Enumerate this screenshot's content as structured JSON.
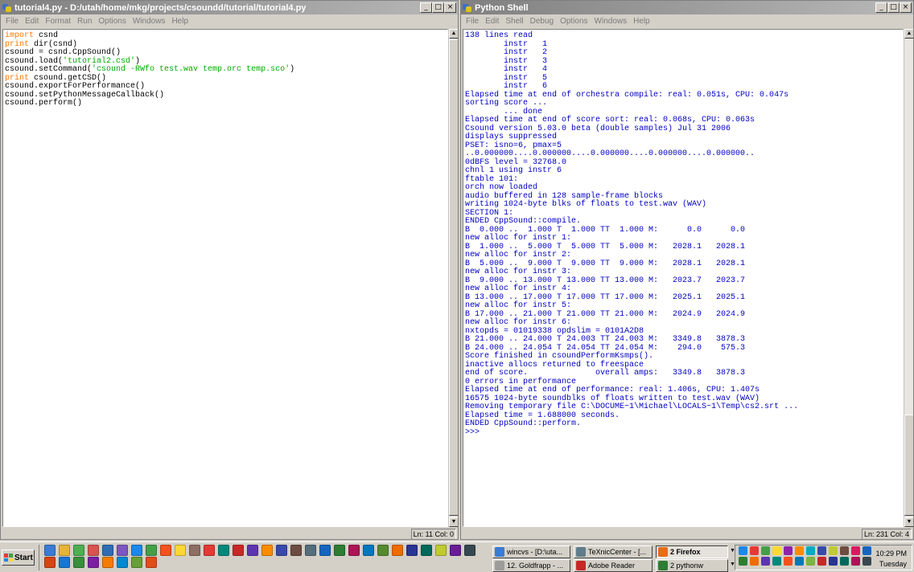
{
  "left_window": {
    "title": "tutorial4.py - D:/utah/home/mkg/projects/csoundd/tutorial/tutorial4.py",
    "caption_buttons": [
      "_",
      "□",
      "×"
    ],
    "menu": [
      "File",
      "Edit",
      "Format",
      "Run",
      "Options",
      "Windows",
      "Help"
    ],
    "code": [
      [
        {
          "t": "import",
          "c": "kw"
        },
        {
          "t": " csnd",
          "c": ""
        }
      ],
      [
        {
          "t": "print",
          "c": "kw"
        },
        {
          "t": " dir(csnd)",
          "c": ""
        }
      ],
      [
        {
          "t": "csound = csnd.CppSound()",
          "c": ""
        }
      ],
      [
        {
          "t": "csound.load(",
          "c": ""
        },
        {
          "t": "'tutorial2.csd'",
          "c": "str"
        },
        {
          "t": ")",
          "c": ""
        }
      ],
      [
        {
          "t": "csound.setCommand(",
          "c": ""
        },
        {
          "t": "'csound -RWfo test.wav temp.orc temp.sco'",
          "c": "str"
        },
        {
          "t": ")",
          "c": ""
        }
      ],
      [
        {
          "t": "print",
          "c": "kw"
        },
        {
          "t": " csound.getCSD()",
          "c": ""
        }
      ],
      [
        {
          "t": "csound.exportForPerformance()",
          "c": ""
        }
      ],
      [
        {
          "t": "csound.setPythonMessageCallback()",
          "c": ""
        }
      ],
      [
        {
          "t": "csound.perform()",
          "c": ""
        }
      ]
    ],
    "status": "Ln: 11 Col: 0"
  },
  "right_window": {
    "title": "Python Shell",
    "caption_buttons": [
      "_",
      "□",
      "×"
    ],
    "menu": [
      "File",
      "Edit",
      "Shell",
      "Debug",
      "Options",
      "Windows",
      "Help"
    ],
    "output": [
      "138 lines read",
      "        instr   1",
      "        instr   2",
      "        instr   3",
      "        instr   4",
      "        instr   5",
      "        instr   6",
      "Elapsed time at end of orchestra compile: real: 0.051s, CPU: 0.047s",
      "sorting score ...",
      "        ... done",
      "Elapsed time at end of score sort: real: 0.068s, CPU: 0.063s",
      "Csound version 5.03.0 beta (double samples) Jul 31 2006",
      "displays suppressed",
      "PSET: isno=6, pmax=5",
      "..0.000000....0.000000....0.000000....0.000000....0.000000..",
      "0dBFS level = 32768.0",
      "chnl 1 using instr 6",
      "ftable 101:",
      "orch now loaded",
      "audio buffered in 128 sample-frame blocks",
      "writing 1024-byte blks of floats to test.wav (WAV)",
      "SECTION 1:",
      "ENDED CppSound::compile.",
      "B  0.000 ..  1.000 T  1.000 TT  1.000 M:      0.0      0.0",
      "new alloc for instr 1:",
      "B  1.000 ..  5.000 T  5.000 TT  5.000 M:   2028.1   2028.1",
      "new alloc for instr 2:",
      "B  5.000 ..  9.000 T  9.000 TT  9.000 M:   2028.1   2028.1",
      "new alloc for instr 3:",
      "B  9.000 .. 13.000 T 13.000 TT 13.000 M:   2023.7   2023.7",
      "new alloc for instr 4:",
      "B 13.000 .. 17.000 T 17.000 TT 17.000 M:   2025.1   2025.1",
      "new alloc for instr 5:",
      "B 17.000 .. 21.000 T 21.000 TT 21.000 M:   2024.9   2024.9",
      "new alloc for instr 6:",
      "nxtopds = 01019338 opdslim = 0101A2D8",
      "B 21.000 .. 24.000 T 24.003 TT 24.003 M:   3349.8   3878.3",
      "B 24.000 .. 24.054 T 24.054 TT 24.054 M:    294.0    575.3",
      "Score finished in csoundPerformKsmps().",
      "inactive allocs returned to freespace",
      "end of score.              overall amps:   3349.8   3878.3",
      "0 errors in performance",
      "Elapsed time at end of performance: real: 1.406s, CPU: 1.407s",
      "16575 1024-byte soundblks of floats written to test.wav (WAV)",
      "Removing temporary file C:\\DOCUME~1\\Michael\\LOCALS~1\\Temp\\cs2.srt ...",
      "Elapsed time = 1.688000 seconds.",
      "ENDED CppSound::perform.",
      ">>> "
    ],
    "status": "Ln: 231 Col: 4"
  },
  "taskbar": {
    "start_label": "Start",
    "quicklaunch_colors": [
      "#3a7bd5",
      "#e8b33a",
      "#4caf50",
      "#d9534f",
      "#2e6db4",
      "#7e57c2",
      "#1e88e5",
      "#43a047",
      "#f4511e",
      "#fdd835",
      "#8d6e63",
      "#e53935",
      "#00897b",
      "#c62828",
      "#5e35b1",
      "#fb8c00",
      "#3949ab",
      "#6d4c41",
      "#546e7a",
      "#1565c0",
      "#2e7d32",
      "#ad1457",
      "#0277bd",
      "#558b2f",
      "#ef6c00",
      "#283593",
      "#00695c",
      "#c0ca33",
      "#6a1b9a",
      "#37474f",
      "#d84315",
      "#1976d2",
      "#388e3c",
      "#7b1fa2",
      "#f57c00",
      "#0288d1",
      "#689f38",
      "#e64a19"
    ],
    "tasks": [
      {
        "label": "wincvs - [D:\\uta...",
        "color": "#3a7bd5",
        "active": false
      },
      {
        "label": "TeXnicCenter - [...",
        "color": "#607d8b",
        "active": false
      },
      {
        "label": "2 Firefox",
        "color": "#e86c1a",
        "active": true
      },
      {
        "label": "12. Goldfrapp - ...",
        "color": "#9c9c9c",
        "active": false
      },
      {
        "label": "Adobe Reader",
        "color": "#c62828",
        "active": false
      },
      {
        "label": "2 pythonw",
        "color": "#2e7d32",
        "active": false
      }
    ],
    "tray_colors": [
      "#1e88e5",
      "#e53935",
      "#43a047",
      "#fdd835",
      "#8e24aa",
      "#fb8c00",
      "#00acc1",
      "#3949ab",
      "#c0ca33",
      "#6d4c41",
      "#d81b60",
      "#1565c0",
      "#2e7d32",
      "#ef6c00",
      "#5e35b1",
      "#00897b",
      "#f4511e",
      "#0277bd",
      "#7cb342",
      "#c62828",
      "#283593",
      "#00695c",
      "#ad1457",
      "#37474f"
    ],
    "clock_time": "10:29 PM",
    "clock_day": "Tuesday"
  }
}
